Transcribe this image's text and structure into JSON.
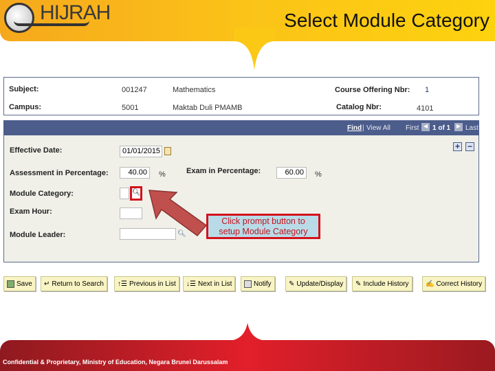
{
  "header": {
    "logo": "HIJRAH",
    "title": "Select Module Category"
  },
  "info": {
    "subject_label": "Subject:",
    "subject_code": "001247",
    "subject_name": "Mathematics",
    "offering_label": "Course Offering Nbr:",
    "offering_value": "1",
    "campus_label": "Campus:",
    "campus_code": "5001",
    "campus_name": "Maktab Duli PMAMB",
    "catalog_label": "Catalog Nbr:",
    "catalog_value": "4101"
  },
  "nav": {
    "find": "Find",
    "sep": "|",
    "view_all": "View All",
    "first": "First",
    "count": "1 of 1",
    "last": "Last"
  },
  "form": {
    "effective_date_label": "Effective Date:",
    "effective_date": "01/01/2015",
    "assessment_label": "Assessment in Percentage:",
    "assessment_value": "40.00",
    "exam_label": "Exam in Percentage:",
    "exam_value": "60.00",
    "percent": "%",
    "module_category_label": "Module Category:",
    "module_category_value": "",
    "exam_hour_label": "Exam Hour:",
    "exam_hour_value": "",
    "module_leader_label": "Module Leader:",
    "module_leader_value": ""
  },
  "callout": {
    "line1": "Click prompt button to",
    "line2": "setup Module Category"
  },
  "toolbar": {
    "save": "Save",
    "return": "Return to Search",
    "previous": "Previous in List",
    "next": "Next in List",
    "notify": "Notify",
    "update": "Update/Display",
    "include": "Include History",
    "correct": "Correct History"
  },
  "footer": {
    "text": "Confidential & Proprietary, Ministry of Education, Negara Brunei Darussalam"
  }
}
